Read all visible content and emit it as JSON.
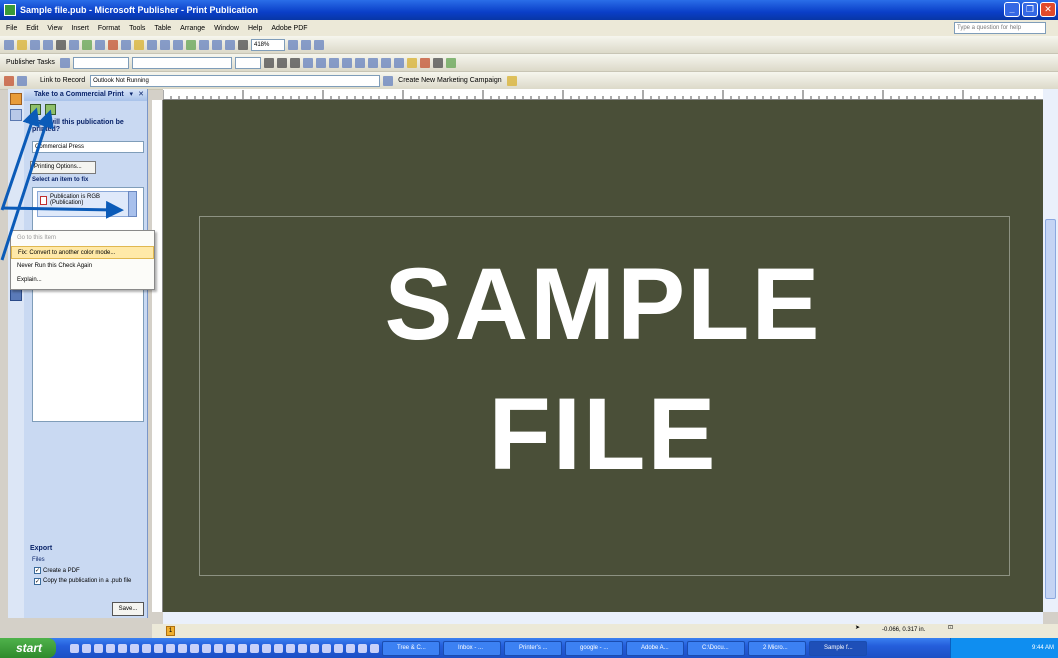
{
  "window": {
    "title": "Sample file.pub - Microsoft Publisher - Print Publication",
    "help_placeholder": "Type a question for help"
  },
  "menu": [
    "File",
    "Edit",
    "View",
    "Insert",
    "Format",
    "Tools",
    "Table",
    "Arrange",
    "Window",
    "Help",
    "Adobe PDF"
  ],
  "toolbar2": {
    "publisher_tasks": "Publisher Tasks"
  },
  "toolbar1": {
    "zoom": "418%"
  },
  "toolbar3": {
    "link_to_record": "Link to Record",
    "outlook_status": "Outlook Not Running",
    "create_campaign": "Create New Marketing Campaign"
  },
  "taskpane": {
    "title": "Take to a Commercial Print",
    "question": "How will this publication be printed?",
    "print_select": "Commercial Press",
    "printing_options": "Printing Options...",
    "select_item": "Select an item to fix",
    "item_line1": "Publication is RGB",
    "item_line2": "(Publication)",
    "export_header": "Export",
    "files_label": "Files",
    "create_pdf": "Create a PDF",
    "copy_pub": "Copy the publication in a .pub file",
    "save_button": "Save..."
  },
  "context_menu": {
    "go_to_item": "Go to this Item",
    "fix": "Fix: Convert to another color mode...",
    "never_run": "Never Run this Check Again",
    "explain": "Explain..."
  },
  "canvas": {
    "line1": "SAMPLE",
    "line2": "FILE",
    "bg_color": "#4a4f38"
  },
  "statusbar": {
    "page": "1",
    "coords": "-0.066, 0.317 in."
  },
  "taskbar": {
    "start": "start",
    "tasks": [
      "Tree & C...",
      "Inbox - ...",
      "Printer's ...",
      "google - ...",
      "Adobe A...",
      "C:\\Docu...",
      "2 Micro...",
      "Sample f..."
    ],
    "clock": "9:44 AM"
  },
  "colors": {
    "title_blue": "#0a3fc8",
    "arrow_blue": "#0b5bb8",
    "taskbar_green": "#3a9a36"
  }
}
